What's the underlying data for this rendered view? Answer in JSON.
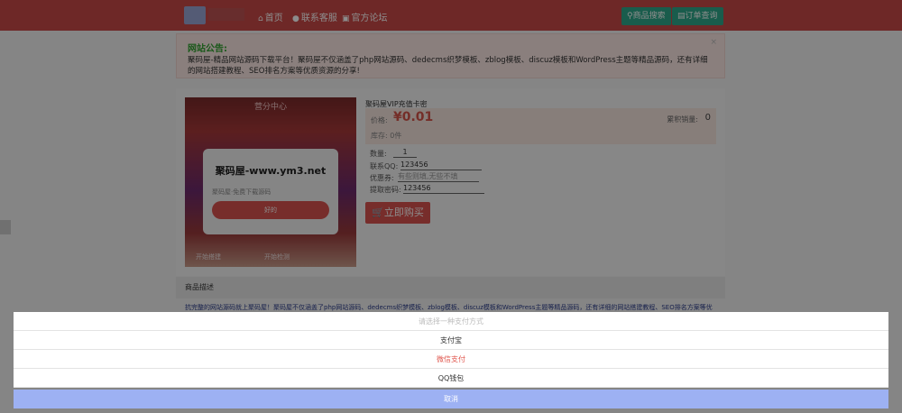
{
  "header": {
    "nav": [
      {
        "icon": "home-icon",
        "label": "首页"
      },
      {
        "icon": "chat-icon",
        "label": "联系客服"
      },
      {
        "icon": "forum-icon",
        "label": "官方论坛"
      }
    ],
    "search_button": "商品搜索",
    "order_button": "订单查询"
  },
  "notice": {
    "title": "网站公告:",
    "text": "聚码屋-精品网站源码下载平台！聚码屋不仅涵盖了php网站源码、dedecms织梦模板、zblog模板、discuz模板和WordPress主题等精品源码，还有详细的网站搭建教程、SEO排名方案等优质资源的分享!",
    "close": "×"
  },
  "product_image": {
    "header": "营分中心",
    "card_title": "聚码屋-www.ym3.net",
    "card_sub": "聚码屋·免费下载源码",
    "card_button": "好的",
    "foot_left": "开始搭建",
    "foot_right": "开始检测"
  },
  "product": {
    "name": "聚码屋VIP充值卡密",
    "price_label": "价格:",
    "price": "¥0.01",
    "sold_label": "累积销量:",
    "sold_value": "0",
    "stock": "库存: 0件",
    "quantity_label": "数量:",
    "quantity": "1",
    "contact_label": "联系QQ:",
    "contact": "123456",
    "coupon_label": "优惠券:",
    "coupon_placeholder": "有些则填,无些不填",
    "code_label": "提取密码:",
    "code": "123456",
    "buy_button": "立即购买"
  },
  "description": {
    "header": "商品描述",
    "text": "抗完整的网站源码就上聚码屋！聚码屋不仅涵盖了php网站源码、dedecms织梦模板、zblog模板、discuz模板和WordPress主题等精品源码，还有详细的网站搭建教程、SEO排名方案等优"
  },
  "payment_sheet": {
    "title": "请选择一种支付方式",
    "options": [
      "支付宝",
      "微信支付",
      "QQ钱包"
    ],
    "cancel": "取消"
  },
  "colors": {
    "header": "#c94a47",
    "accent_green": "#2fa88a",
    "price_red": "#d4544a",
    "cancel_blue": "#9db1f3"
  }
}
